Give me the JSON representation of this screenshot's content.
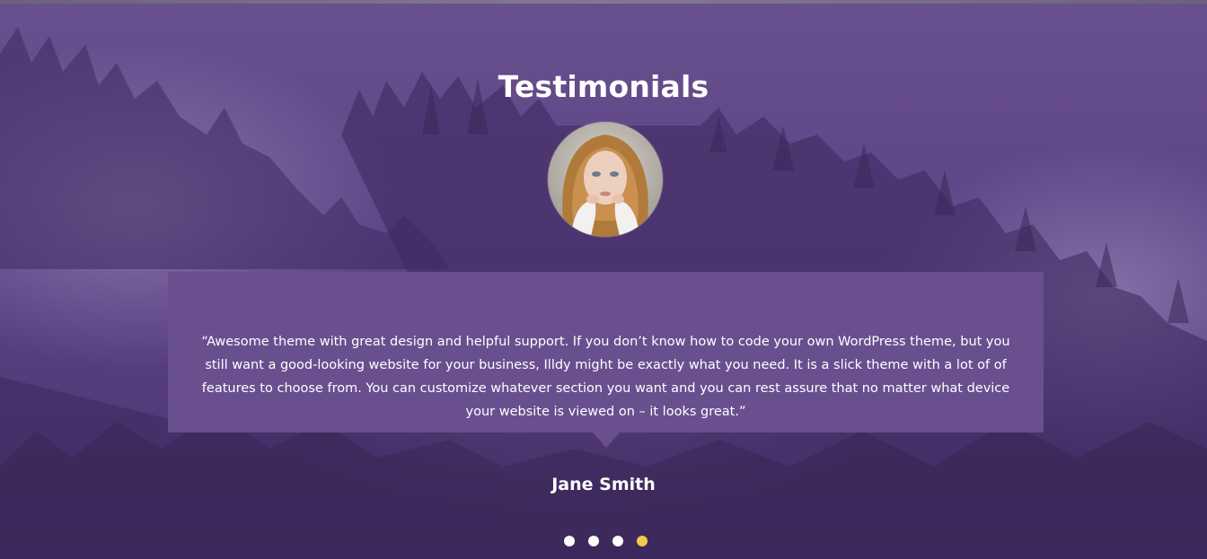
{
  "section": {
    "title": "Testimonials"
  },
  "testimonial": {
    "quote": "“Awesome theme with great design and helpful support. If you don’t know how to code your own WordPress theme, but you still want a good-looking website for your business, Illdy might be exactly what you need. It is a slick theme with a lot of of features to choose from. You can customize whatever section you want and you can rest assure that no matter what device your website is viewed on – it looks great.”",
    "author": "Jane Smith",
    "avatar_icon": "person-photo"
  },
  "carousel": {
    "total": 4,
    "active_index": 3
  },
  "colors": {
    "overlay": "#5e4585",
    "quote_box": "#6a4f8f",
    "dot": "#ffffff",
    "dot_active": "#f2c94c"
  }
}
